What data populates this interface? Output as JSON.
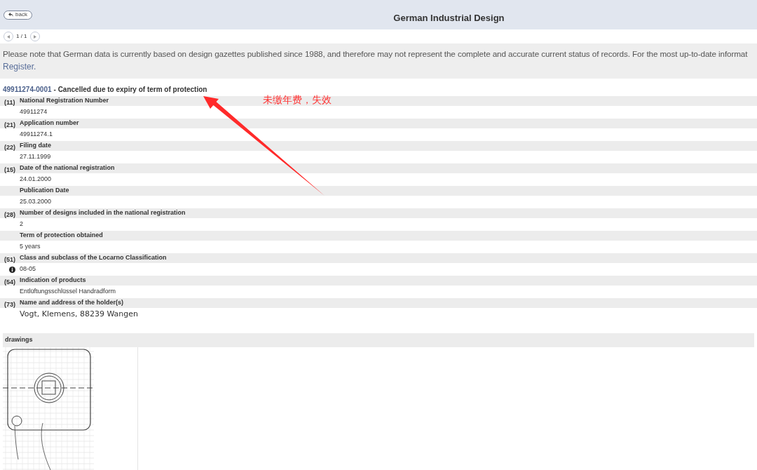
{
  "header": {
    "back_button": "back",
    "title": "German Industrial Design"
  },
  "pager": {
    "text": "1 / 1"
  },
  "notice": {
    "text": "Please note that German data is currently based on design gazettes published since 1988, and therefore may not represent the complete and accurate current status of records. For the most up-to-date informat",
    "link": "Register."
  },
  "record": {
    "number": "49911274-0001",
    "status": "- Cancelled due to expiry of term of protection"
  },
  "fields": [
    {
      "kind": "text",
      "code": "(11)",
      "label": "National Registration Number",
      "value": "49911274"
    },
    {
      "kind": "text",
      "code": "(21)",
      "label": "Application number",
      "value": "49911274.1"
    },
    {
      "kind": "text",
      "code": "(22)",
      "label": "Filing date",
      "value": "27.11.1999"
    },
    {
      "kind": "text",
      "code": "(15)",
      "label": "Date of the national registration",
      "value": "24.01.2000"
    },
    {
      "kind": "text",
      "label": "Publication Date",
      "value": "25.03.2000"
    },
    {
      "kind": "text",
      "code": "(28)",
      "label": "Number of designs included in the national registration",
      "value": "2"
    },
    {
      "kind": "text",
      "label": "Term of protection obtained",
      "value": "5 years"
    },
    {
      "kind": "info",
      "code": "(51)",
      "label": "Class and subclass of the Locarno Classification",
      "value": "08-05"
    },
    {
      "kind": "text",
      "code": "(54)",
      "label": "Indication of products",
      "value": "Entlüftungsschlüssel Handradform"
    },
    {
      "kind": "holder",
      "code": "(73)",
      "label": "Name and address of the holder(s)",
      "value": "Vogt, Klemens, 88239 Wangen"
    }
  ],
  "drawings": {
    "title": "drawings"
  },
  "annotation": {
    "text": "未缴年费，失效"
  }
}
